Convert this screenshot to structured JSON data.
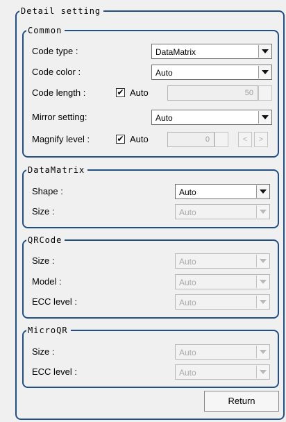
{
  "detail": {
    "title": "Detail setting"
  },
  "common": {
    "title": "Common",
    "code_type": {
      "label": "Code type :",
      "value": "DataMatrix"
    },
    "code_color": {
      "label": "Code color :",
      "value": "Auto"
    },
    "code_length": {
      "label": "Code length :",
      "checkbox_label": "Auto",
      "checked": true,
      "value": "50"
    },
    "mirror": {
      "label": "Mirror setting:",
      "value": "Auto"
    },
    "magnify": {
      "label": "Magnify level :",
      "checkbox_label": "Auto",
      "checked": true,
      "value": "0",
      "prev": "<",
      "next": ">"
    }
  },
  "datamatrix": {
    "title": "DataMatrix",
    "shape": {
      "label": "Shape :",
      "value": "Auto"
    },
    "size": {
      "label": "Size :",
      "value": "Auto"
    }
  },
  "qrcode": {
    "title": "QRCode",
    "size": {
      "label": "Size :",
      "value": "Auto"
    },
    "model": {
      "label": "Model :",
      "value": "Auto"
    },
    "ecc": {
      "label": "ECC level :",
      "value": "Auto"
    }
  },
  "microqr": {
    "title": "MicroQR",
    "size": {
      "label": "Size :",
      "value": "Auto"
    },
    "ecc": {
      "label": "ECC level :",
      "value": "Auto"
    }
  },
  "footer": {
    "return_label": "Return"
  },
  "colors": {
    "border": "#1f4f86",
    "panel": "#f0f0f0",
    "disabled_text": "#a9a9a9"
  }
}
